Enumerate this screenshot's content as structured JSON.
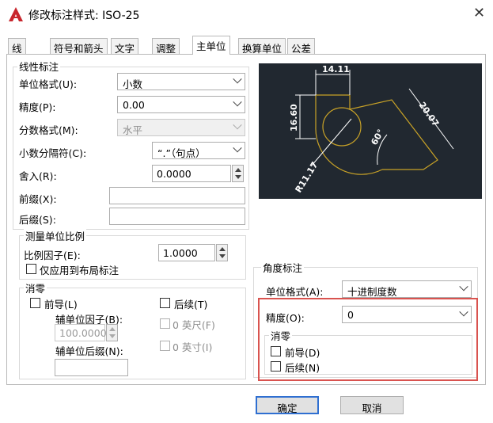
{
  "window": {
    "title": "修改标注样式: ISO-25",
    "close_symbol": "✕"
  },
  "tabs": [
    "线",
    "符号和箭头",
    "文字",
    "调整",
    "主单位",
    "换算单位",
    "公差"
  ],
  "active_tab": "主单位",
  "linear": {
    "group_title": "线性标注",
    "unit_format_label": "单位格式(U):",
    "unit_format_value": "小数",
    "precision_label": "精度(P):",
    "precision_value": "0.00",
    "fraction_format_label": "分数格式(M):",
    "fraction_format_value": "水平",
    "decimal_separator_label": "小数分隔符(C):",
    "decimal_separator_value": "“.”（句点）",
    "round_off_label": "舍入(R):",
    "round_off_value": "0.0000",
    "prefix_label": "前缀(X):",
    "prefix_value": "",
    "suffix_label": "后缀(S):",
    "suffix_value": ""
  },
  "measurement_scale": {
    "group_title": "测量单位比例",
    "scale_factor_label": "比例因子(E):",
    "scale_factor_value": "1.0000",
    "layout_only_label": "仅应用到布局标注"
  },
  "zero_suppression": {
    "group_title": "消零",
    "leading_label": "前导(L)",
    "trailing_label": "后续(T)",
    "sub_unit_factor_label": "辅单位因子(B):",
    "sub_unit_factor_value": "100.0000",
    "feet_label": "0 英尺(F)",
    "sub_unit_suffix_label": "辅单位后缀(N):",
    "sub_unit_suffix_value": "",
    "inches_label": "0 英寸(I)"
  },
  "angular": {
    "group_title": "角度标注",
    "unit_format_label": "单位格式(A):",
    "unit_format_value": "十进制度数",
    "precision_label": "精度(O):",
    "precision_value": "0",
    "zero_group_title": "消零",
    "leading_label": "前导(D)",
    "trailing_label": "后续(N)"
  },
  "preview": {
    "dim_top": "14.11",
    "dim_left": "16.60",
    "dim_diag": "20.07",
    "dim_angle": "60°",
    "dim_radius": "R11.17"
  },
  "buttons": {
    "ok": "确定",
    "cancel": "取消"
  },
  "colors": {
    "accent": "#2f6fd1",
    "highlight": "#d9534f",
    "preview_bg": "#212830",
    "preview_line": "#ffffff",
    "preview_shape": "#c8a227"
  }
}
